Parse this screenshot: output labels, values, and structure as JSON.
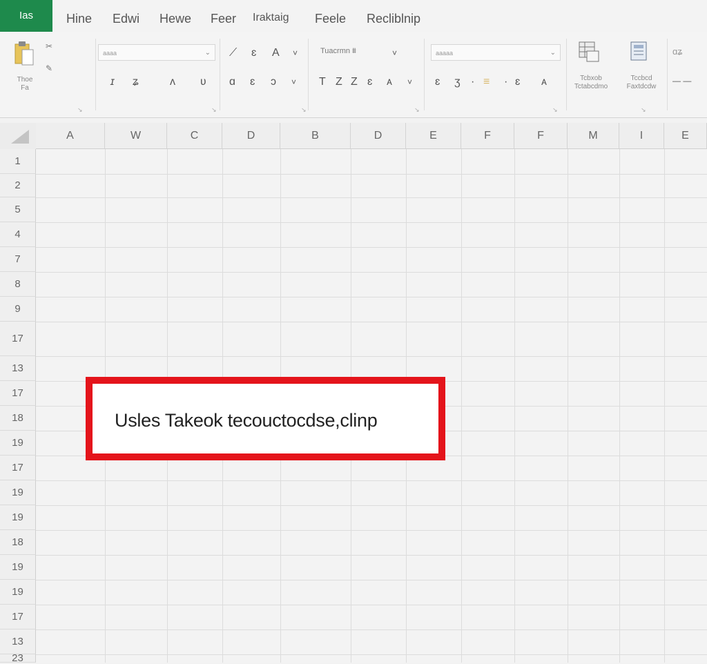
{
  "menu": {
    "file_tab": "Ias",
    "tabs": [
      "Hine",
      "Edwi",
      "Hewe",
      "Feer",
      "Iraktaig",
      "Feele",
      "Recliblnip"
    ]
  },
  "ribbon": {
    "clipboard": {
      "paste_label": "Thoe\nFa"
    },
    "font": {
      "font_name": "aaaa",
      "font_row_icons": [
        "a",
        "c",
        "A'",
        "˅"
      ],
      "style_row_icons": [
        "ɪ",
        "ʑ",
        "ʌ",
        "ʋ"
      ]
    },
    "alignment": {
      "row1_icons": [
        "⟋",
        "ɛ",
        "A",
        "˅"
      ],
      "row2_icons": [
        "ɑ",
        "ɛ",
        "ɔ",
        "˅"
      ]
    },
    "number": {
      "format_text": "Tuacrmn ⩩",
      "row2_icons": [
        "T",
        "Z",
        "Z",
        "ɛ",
        "ᴀ",
        "˅"
      ]
    },
    "styles": {
      "combo_text": "aaaaa",
      "row2_icons": [
        "ɛ",
        "ʒ",
        "·",
        "≡",
        "·",
        "ɛ",
        "ᴀ"
      ]
    },
    "cells": {
      "btn1_label": "Tcbxob\nTctabcdmo",
      "btn2_label": "Tccbcd\nFaxtdcdw"
    },
    "editing": {
      "icon1": "ɑʑ",
      "icon2": "—  —"
    }
  },
  "grid": {
    "columns": [
      "A",
      "W",
      "C",
      "D",
      "B",
      "D",
      "E",
      "F",
      "F",
      "M",
      "I",
      "E"
    ],
    "rows": [
      "1",
      "2",
      "5",
      "4",
      "7",
      "8",
      "9",
      "17",
      "13",
      "17",
      "18",
      "19",
      "17",
      "19",
      "19",
      "18",
      "19",
      "19",
      "17",
      "13",
      "23"
    ]
  },
  "callout": {
    "text": "Usles Takeok tecouctocdse,clinp",
    "border_color": "#e4141b"
  },
  "colors": {
    "accent": "#1e8a4c"
  }
}
